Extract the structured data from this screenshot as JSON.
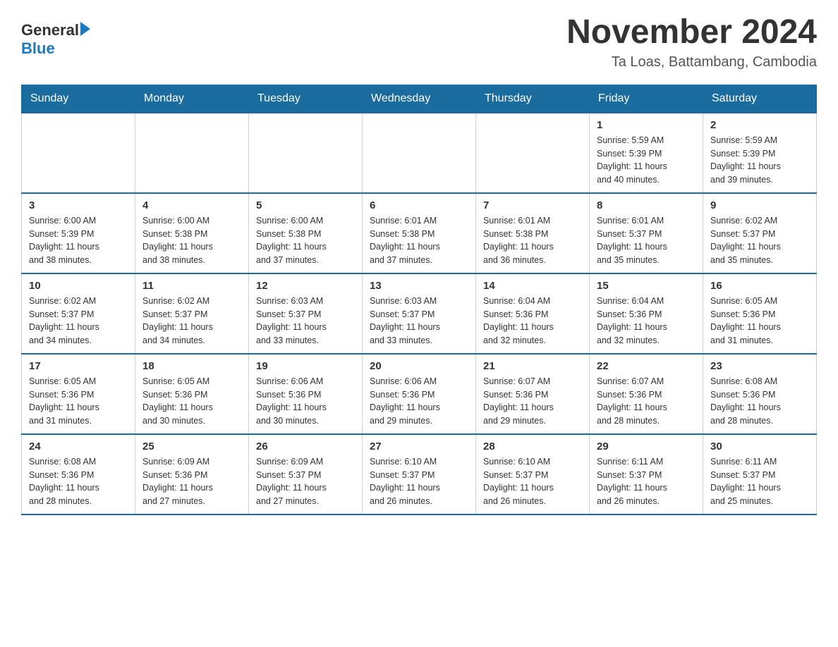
{
  "logo": {
    "text_general": "General",
    "text_blue": "Blue",
    "triangle_char": "▶"
  },
  "header": {
    "title": "November 2024",
    "subtitle": "Ta Loas, Battambang, Cambodia"
  },
  "days_of_week": [
    "Sunday",
    "Monday",
    "Tuesday",
    "Wednesday",
    "Thursday",
    "Friday",
    "Saturday"
  ],
  "weeks": [
    {
      "days": [
        {
          "number": "",
          "info": ""
        },
        {
          "number": "",
          "info": ""
        },
        {
          "number": "",
          "info": ""
        },
        {
          "number": "",
          "info": ""
        },
        {
          "number": "",
          "info": ""
        },
        {
          "number": "1",
          "info": "Sunrise: 5:59 AM\nSunset: 5:39 PM\nDaylight: 11 hours\nand 40 minutes."
        },
        {
          "number": "2",
          "info": "Sunrise: 5:59 AM\nSunset: 5:39 PM\nDaylight: 11 hours\nand 39 minutes."
        }
      ]
    },
    {
      "days": [
        {
          "number": "3",
          "info": "Sunrise: 6:00 AM\nSunset: 5:39 PM\nDaylight: 11 hours\nand 38 minutes."
        },
        {
          "number": "4",
          "info": "Sunrise: 6:00 AM\nSunset: 5:38 PM\nDaylight: 11 hours\nand 38 minutes."
        },
        {
          "number": "5",
          "info": "Sunrise: 6:00 AM\nSunset: 5:38 PM\nDaylight: 11 hours\nand 37 minutes."
        },
        {
          "number": "6",
          "info": "Sunrise: 6:01 AM\nSunset: 5:38 PM\nDaylight: 11 hours\nand 37 minutes."
        },
        {
          "number": "7",
          "info": "Sunrise: 6:01 AM\nSunset: 5:38 PM\nDaylight: 11 hours\nand 36 minutes."
        },
        {
          "number": "8",
          "info": "Sunrise: 6:01 AM\nSunset: 5:37 PM\nDaylight: 11 hours\nand 35 minutes."
        },
        {
          "number": "9",
          "info": "Sunrise: 6:02 AM\nSunset: 5:37 PM\nDaylight: 11 hours\nand 35 minutes."
        }
      ]
    },
    {
      "days": [
        {
          "number": "10",
          "info": "Sunrise: 6:02 AM\nSunset: 5:37 PM\nDaylight: 11 hours\nand 34 minutes."
        },
        {
          "number": "11",
          "info": "Sunrise: 6:02 AM\nSunset: 5:37 PM\nDaylight: 11 hours\nand 34 minutes."
        },
        {
          "number": "12",
          "info": "Sunrise: 6:03 AM\nSunset: 5:37 PM\nDaylight: 11 hours\nand 33 minutes."
        },
        {
          "number": "13",
          "info": "Sunrise: 6:03 AM\nSunset: 5:37 PM\nDaylight: 11 hours\nand 33 minutes."
        },
        {
          "number": "14",
          "info": "Sunrise: 6:04 AM\nSunset: 5:36 PM\nDaylight: 11 hours\nand 32 minutes."
        },
        {
          "number": "15",
          "info": "Sunrise: 6:04 AM\nSunset: 5:36 PM\nDaylight: 11 hours\nand 32 minutes."
        },
        {
          "number": "16",
          "info": "Sunrise: 6:05 AM\nSunset: 5:36 PM\nDaylight: 11 hours\nand 31 minutes."
        }
      ]
    },
    {
      "days": [
        {
          "number": "17",
          "info": "Sunrise: 6:05 AM\nSunset: 5:36 PM\nDaylight: 11 hours\nand 31 minutes."
        },
        {
          "number": "18",
          "info": "Sunrise: 6:05 AM\nSunset: 5:36 PM\nDaylight: 11 hours\nand 30 minutes."
        },
        {
          "number": "19",
          "info": "Sunrise: 6:06 AM\nSunset: 5:36 PM\nDaylight: 11 hours\nand 30 minutes."
        },
        {
          "number": "20",
          "info": "Sunrise: 6:06 AM\nSunset: 5:36 PM\nDaylight: 11 hours\nand 29 minutes."
        },
        {
          "number": "21",
          "info": "Sunrise: 6:07 AM\nSunset: 5:36 PM\nDaylight: 11 hours\nand 29 minutes."
        },
        {
          "number": "22",
          "info": "Sunrise: 6:07 AM\nSunset: 5:36 PM\nDaylight: 11 hours\nand 28 minutes."
        },
        {
          "number": "23",
          "info": "Sunrise: 6:08 AM\nSunset: 5:36 PM\nDaylight: 11 hours\nand 28 minutes."
        }
      ]
    },
    {
      "days": [
        {
          "number": "24",
          "info": "Sunrise: 6:08 AM\nSunset: 5:36 PM\nDaylight: 11 hours\nand 28 minutes."
        },
        {
          "number": "25",
          "info": "Sunrise: 6:09 AM\nSunset: 5:36 PM\nDaylight: 11 hours\nand 27 minutes."
        },
        {
          "number": "26",
          "info": "Sunrise: 6:09 AM\nSunset: 5:37 PM\nDaylight: 11 hours\nand 27 minutes."
        },
        {
          "number": "27",
          "info": "Sunrise: 6:10 AM\nSunset: 5:37 PM\nDaylight: 11 hours\nand 26 minutes."
        },
        {
          "number": "28",
          "info": "Sunrise: 6:10 AM\nSunset: 5:37 PM\nDaylight: 11 hours\nand 26 minutes."
        },
        {
          "number": "29",
          "info": "Sunrise: 6:11 AM\nSunset: 5:37 PM\nDaylight: 11 hours\nand 26 minutes."
        },
        {
          "number": "30",
          "info": "Sunrise: 6:11 AM\nSunset: 5:37 PM\nDaylight: 11 hours\nand 25 minutes."
        }
      ]
    }
  ]
}
